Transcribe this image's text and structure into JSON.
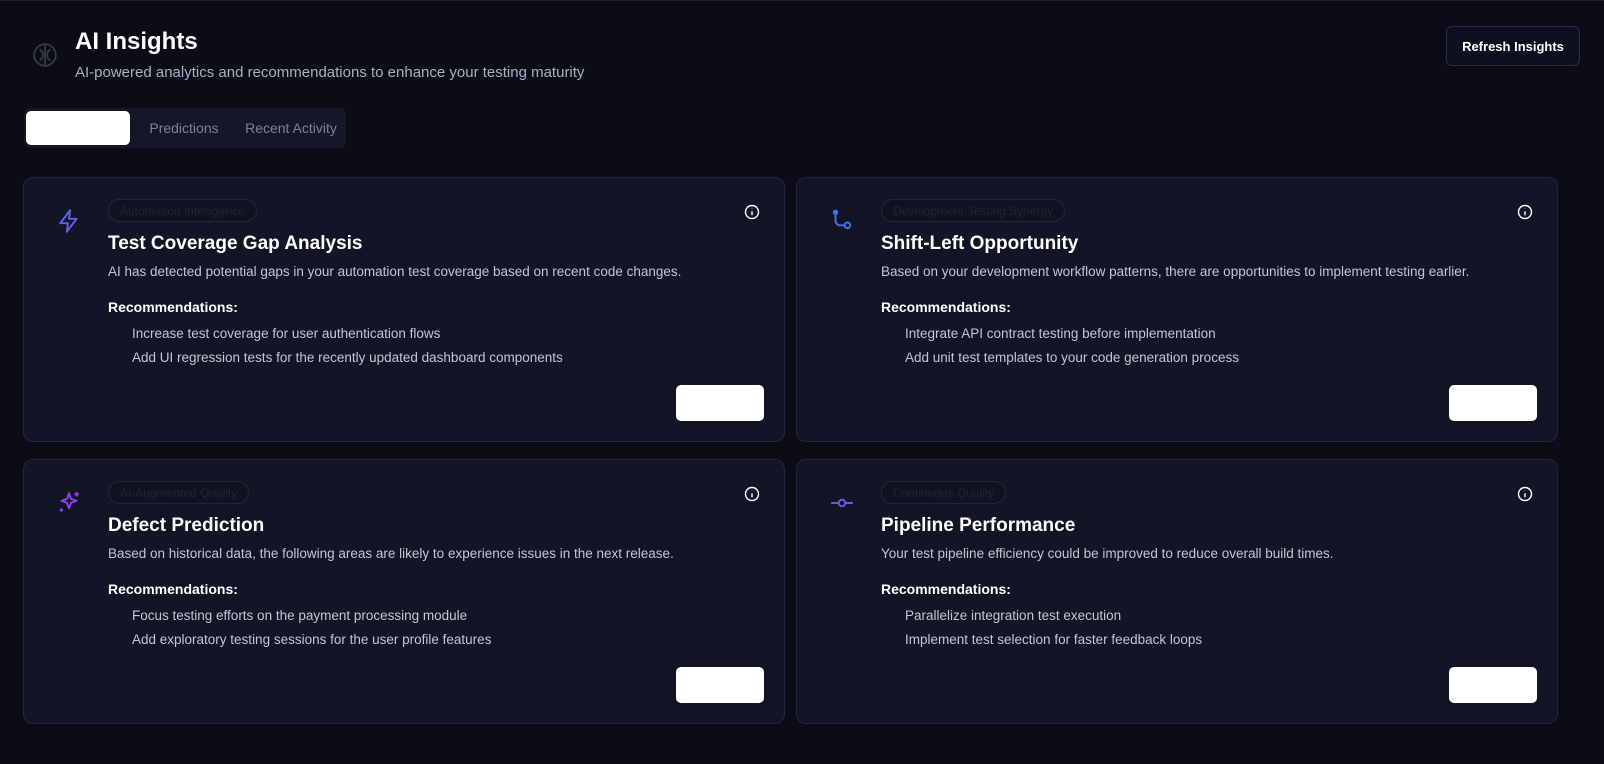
{
  "header": {
    "title": "AI Insights",
    "subtitle": "AI-powered analytics and recommendations to enhance your testing maturity",
    "refresh_label": "Refresh Insights"
  },
  "tabs": [
    {
      "label": ""
    },
    {
      "label": "Predictions"
    },
    {
      "label": "Recent Activity"
    }
  ],
  "cards": [
    {
      "badge": "Automation Intelligence",
      "icon": "lightning-icon",
      "icon_color": "#5b63f0",
      "title": "Test Coverage Gap Analysis",
      "description": "AI has detected potential gaps in your automation test coverage based on recent code changes.",
      "rec_heading": "Recommendations:",
      "recommendations": [
        "Increase test coverage for user authentication flows",
        "Add UI regression tests for the recently updated dashboard components"
      ]
    },
    {
      "badge": "Development-Testing Synergy",
      "icon": "git-branch-icon",
      "icon_color": "#4a6ee8",
      "title": "Shift-Left Opportunity",
      "description": "Based on your development workflow patterns, there are opportunities to implement testing earlier.",
      "rec_heading": "Recommendations:",
      "recommendations": [
        "Integrate API contract testing before implementation",
        "Add unit test templates to your code generation process"
      ]
    },
    {
      "badge": "AI-Augmented Quality",
      "icon": "sparkles-icon",
      "icon_color": "#8a3ff0",
      "title": "Defect Prediction",
      "description": "Based on historical data, the following areas are likely to experience issues in the next release.",
      "rec_heading": "Recommendations:",
      "recommendations": [
        "Focus testing efforts on the payment processing module",
        "Add exploratory testing sessions for the user profile features"
      ]
    },
    {
      "badge": "Continuous Quality",
      "icon": "git-commit-icon",
      "icon_color": "#6a58e8",
      "title": "Pipeline Performance",
      "description": "Your test pipeline efficiency could be improved to reduce overall build times.",
      "rec_heading": "Recommendations:",
      "recommendations": [
        "Parallelize integration test execution",
        "Implement test selection for faster feedback loops"
      ]
    }
  ]
}
